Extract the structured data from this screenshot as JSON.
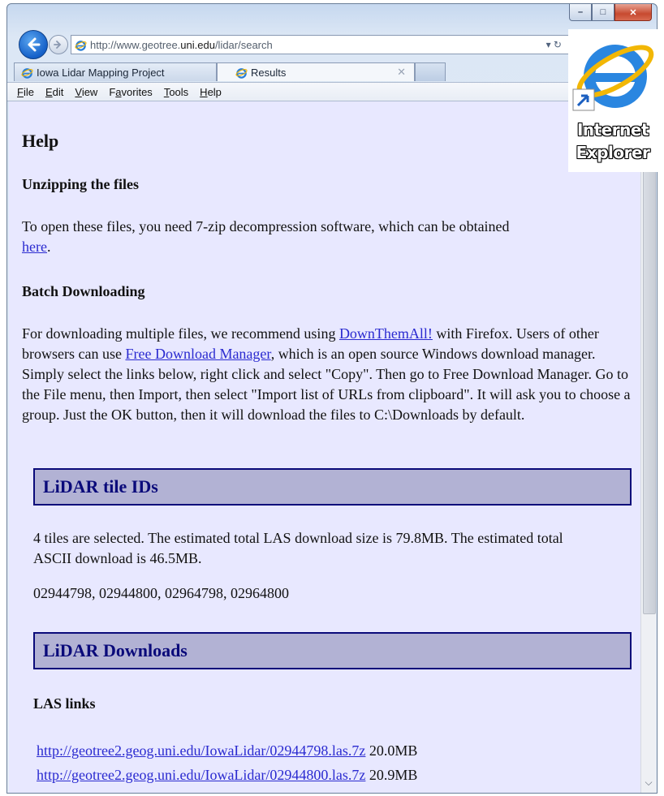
{
  "window": {
    "caption_buttons": {
      "minimize": "–",
      "maximize": "□",
      "close": "✕"
    }
  },
  "nav": {
    "back_icon": "back-arrow-icon",
    "forward_icon": "forward-arrow-icon",
    "address_prefix": "http://www.geotree.",
    "address_domain": "uni.edu",
    "address_suffix": "/lidar/search",
    "address_tools": "▾ ↻"
  },
  "tabs": [
    {
      "label": "Iowa Lidar Mapping Project"
    },
    {
      "label": "Results",
      "close": "✕"
    }
  ],
  "menu": [
    {
      "underline": "F",
      "rest": "ile"
    },
    {
      "underline": "E",
      "rest": "dit"
    },
    {
      "underline": "V",
      "rest": "iew"
    },
    {
      "prefix": "F",
      "underline": "a",
      "rest": "vorites"
    },
    {
      "underline": "T",
      "rest": "ools"
    },
    {
      "underline": "H",
      "rest": "elp"
    }
  ],
  "page": {
    "help_heading": "Help",
    "unzip_heading": "Unzipping the files",
    "unzip_text": "To open these files, you need 7-zip decompression software, which can be obtained",
    "unzip_link": "here",
    "unzip_end": ".",
    "batch_heading": "Batch Downloading",
    "batch_1": "For downloading multiple files, we recommend using ",
    "batch_link1": "DownThemAll!",
    "batch_2": " with Firefox. Users of other browsers can use ",
    "batch_link2": "Free Download Manager",
    "batch_3": ", which is an open source Windows download manager. Simply select the links below, right click and select \"Copy\". Then go to Free Download Manager. Go to the File menu, then Import, then select \"Import list of URLs from clipboard\". It will ask you to choose a group. Just the OK button, then it will download the files to C:\\Downloads by default.",
    "tiles_heading": "LiDAR tile IDs",
    "tiles_text": "4 tiles are selected. The estimated total LAS download size is 79.8MB. The estimated total ASCII download is 46.5MB.",
    "tile_ids": "02944798, 02944800, 02964798, 02964800",
    "downloads_heading": "LiDAR Downloads",
    "las_heading": "LAS links",
    "las_links": [
      {
        "url": "http://geotree2.geog.uni.edu/IowaLidar/02944798.las.7z",
        "size": " 20.0MB"
      },
      {
        "url": "http://geotree2.geog.uni.edu/IowaLidar/02944800.las.7z",
        "size": " 20.9MB"
      }
    ]
  },
  "desktop_icon": {
    "line1": "Internet",
    "line2": "Explorer"
  },
  "colors": {
    "page_bg": "#e8e8ff",
    "section_bg": "#b2b2d4",
    "section_text": "#0a0a7a",
    "link": "#2a2ad0"
  }
}
